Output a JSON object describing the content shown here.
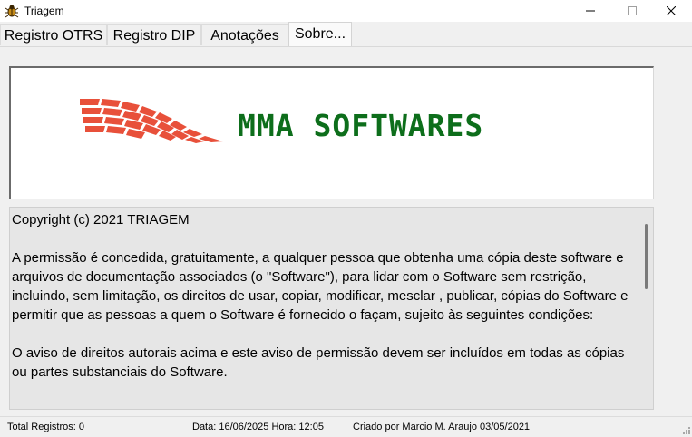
{
  "window": {
    "title": "Triagem",
    "icon": "bug-icon"
  },
  "tabs": [
    {
      "label": "Registro OTRS",
      "active": false
    },
    {
      "label": "Registro DIP",
      "active": false
    },
    {
      "label": "Anotações",
      "active": false
    },
    {
      "label": "Sobre...",
      "active": true
    }
  ],
  "about": {
    "logo_text": "MMA SOFTWARES",
    "brand_color": "#0d6e1b",
    "logo_graphic_color": "#e8503a",
    "license_paragraphs": [
      "Copyright (c) 2021 TRIAGEM",
      "A permissão é concedida, gratuitamente, a qualquer pessoa que obtenha uma cópia deste software e arquivos de documentação associados (o \"Software\"), para lidar com o Software sem restrição, incluindo, sem limitação, os direitos de usar, copiar, modificar, mesclar , publicar, cópias do Software e permitir que as pessoas a quem o Software é fornecido o façam, sujeito às seguintes condições:",
      "O aviso de direitos autorais acima e este aviso de permissão devem ser incluídos em todas as cópias ou partes substanciais do Software."
    ]
  },
  "status": {
    "total": "Total Registros: 0",
    "datetime": "Data: 16/06/2025 Hora: 12:05",
    "credit": "Criado por Marcio M. Araujo 03/05/2021"
  }
}
